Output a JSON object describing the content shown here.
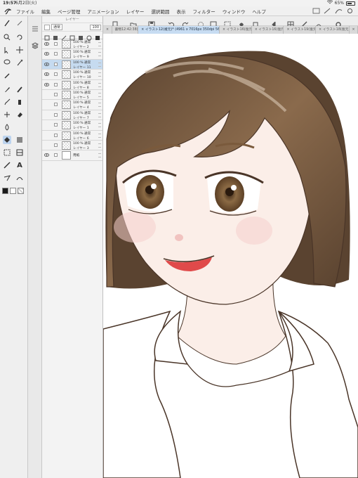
{
  "status": {
    "time": "19:57",
    "date": "6月2日(火)",
    "battery_text": "65%",
    "battery_level": 0.65
  },
  "menu": {
    "items": [
      "ファイル",
      "編集",
      "ページ管理",
      "アニメーション",
      "レイヤー",
      "選択範囲",
      "表示",
      "フィルター",
      "ウィンドウ",
      "ヘルプ"
    ]
  },
  "tabs": [
    {
      "label": "×",
      "active": false
    },
    {
      "label": "書物12:42:38)",
      "active": false
    },
    {
      "label": "× イラスト12(複元)* (4961 x 7016px 350dpi 56.6%)",
      "active": true
    },
    {
      "label": "× イラスト16(復元",
      "active": false
    },
    {
      "label": "× イラスト16(復元",
      "active": false
    },
    {
      "label": "× イラスト19(復元",
      "active": false
    },
    {
      "label": "× イラスト18(復元)",
      "active": false
    },
    {
      "label": "×",
      "active": false
    }
  ],
  "layer_panel": {
    "header": "レイヤー",
    "blend_mode": "通常",
    "opacity": "100",
    "layers": [
      {
        "percent": "100 % 通常",
        "name": "レイヤー 2",
        "visible": true,
        "selected": false,
        "paper": false
      },
      {
        "percent": "100 % 通常",
        "name": "レイヤー 9",
        "visible": true,
        "selected": false,
        "paper": false
      },
      {
        "percent": "100 % 通常",
        "name": "レイヤー 11",
        "visible": true,
        "selected": true,
        "paper": false
      },
      {
        "percent": "100 % 通常",
        "name": "レイヤー 10",
        "visible": true,
        "selected": false,
        "paper": false
      },
      {
        "percent": "100 % 通常",
        "name": "レイヤー 8",
        "visible": true,
        "selected": false,
        "paper": false
      },
      {
        "percent": "100 % 通常",
        "name": "レイヤー 5",
        "visible": false,
        "selected": false,
        "paper": false
      },
      {
        "percent": "100 % 通常",
        "name": "レイヤー 4",
        "visible": false,
        "selected": false,
        "paper": false
      },
      {
        "percent": "100 % 通常",
        "name": "レイヤー 7",
        "visible": false,
        "selected": false,
        "paper": false
      },
      {
        "percent": "100 % 通常",
        "name": "レイヤー 1",
        "visible": false,
        "selected": false,
        "paper": false
      },
      {
        "percent": "100 % 通常",
        "name": "レイヤー 6",
        "visible": false,
        "selected": false,
        "paper": false
      },
      {
        "percent": "100 % 通常",
        "name": "レイヤー 3",
        "visible": false,
        "selected": false,
        "paper": false
      },
      {
        "percent": "",
        "name": "用紙",
        "visible": true,
        "selected": false,
        "paper": true
      }
    ]
  },
  "colors": {
    "accent": "#c6dbf0",
    "hair": "#8a6a4c",
    "hair_dark": "#5a4330",
    "skin": "#fbeee8",
    "blush": "#f6cfcc",
    "lips": "#e04a4a",
    "iris": "#8b6a44",
    "line": "#4a3528"
  }
}
